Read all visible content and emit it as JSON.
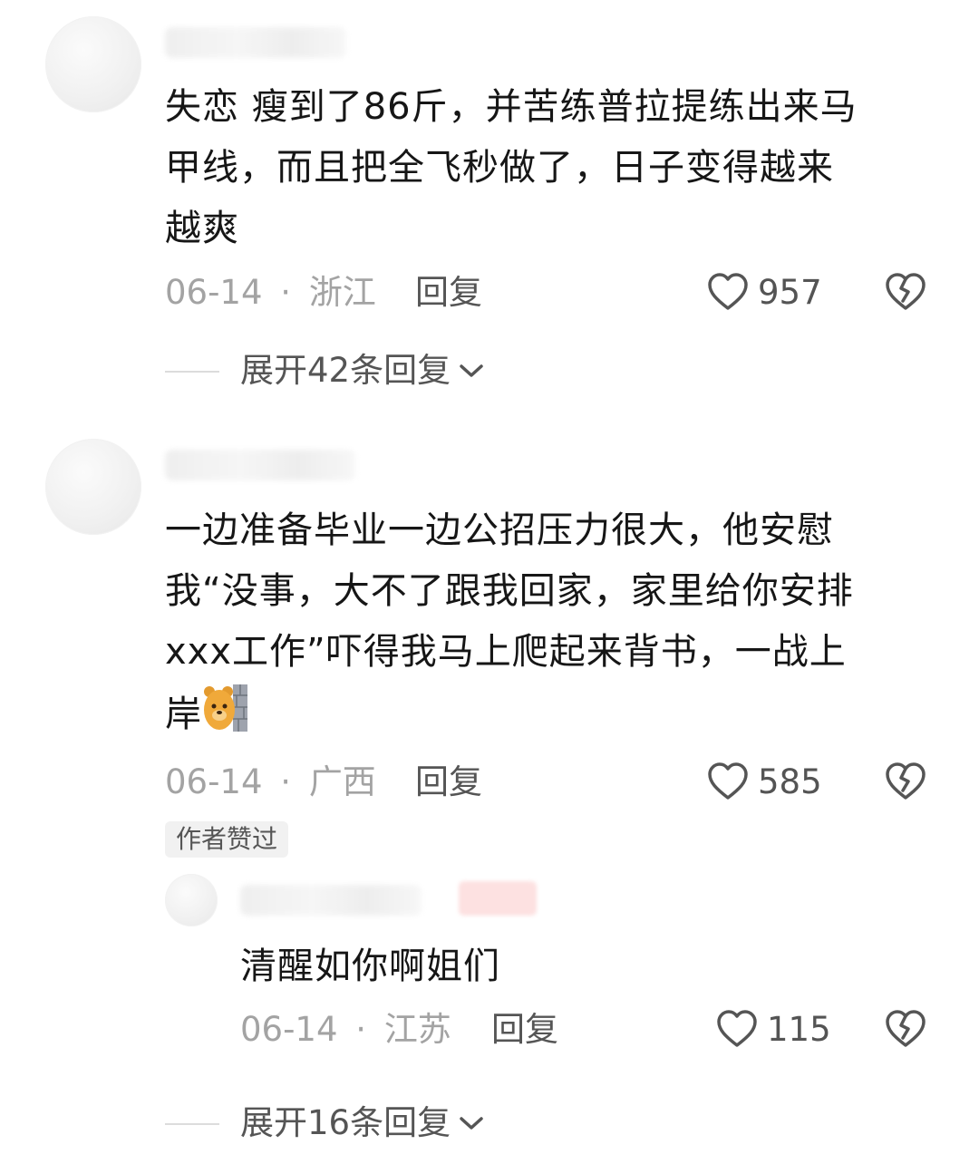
{
  "comments": [
    {
      "text_lines": [
        "失恋 瘦到了86斤，并苦练普拉提练出来马",
        "甲线，而且把全飞秒做了，日子变得越来",
        "越爽"
      ],
      "date": "06-14",
      "sep": "·",
      "region": "浙江",
      "reply_label": "回复",
      "likes": "957",
      "expand_label": "展开42条回复"
    },
    {
      "text_lines": [
        "一边准备毕业一边公招压力很大，他安慰",
        "我“没事，大不了跟我回家，家里给你安排",
        "xxx工作”吓得我马上爬起来背书，一战上",
        "岸"
      ],
      "emoji_icon": "bear-peeking-behind-wall-icon",
      "date": "06-14",
      "sep": "·",
      "region": "广西",
      "reply_label": "回复",
      "likes": "585",
      "author_tag": "作者赞过",
      "sub_reply": {
        "text": "清醒如你啊姐们",
        "date": "06-14",
        "sep": "·",
        "region": "江苏",
        "reply_label": "回复",
        "likes": "115"
      },
      "expand_label": "展开16条回复"
    }
  ],
  "icons": {
    "like": "heart-outline-icon",
    "dislike": "broken-heart-icon",
    "expand": "chevron-down-icon"
  },
  "colors": {
    "text": "#161616",
    "meta": "#a3a3a3",
    "action": "#555555",
    "tag_bg": "#f1f1f1"
  }
}
